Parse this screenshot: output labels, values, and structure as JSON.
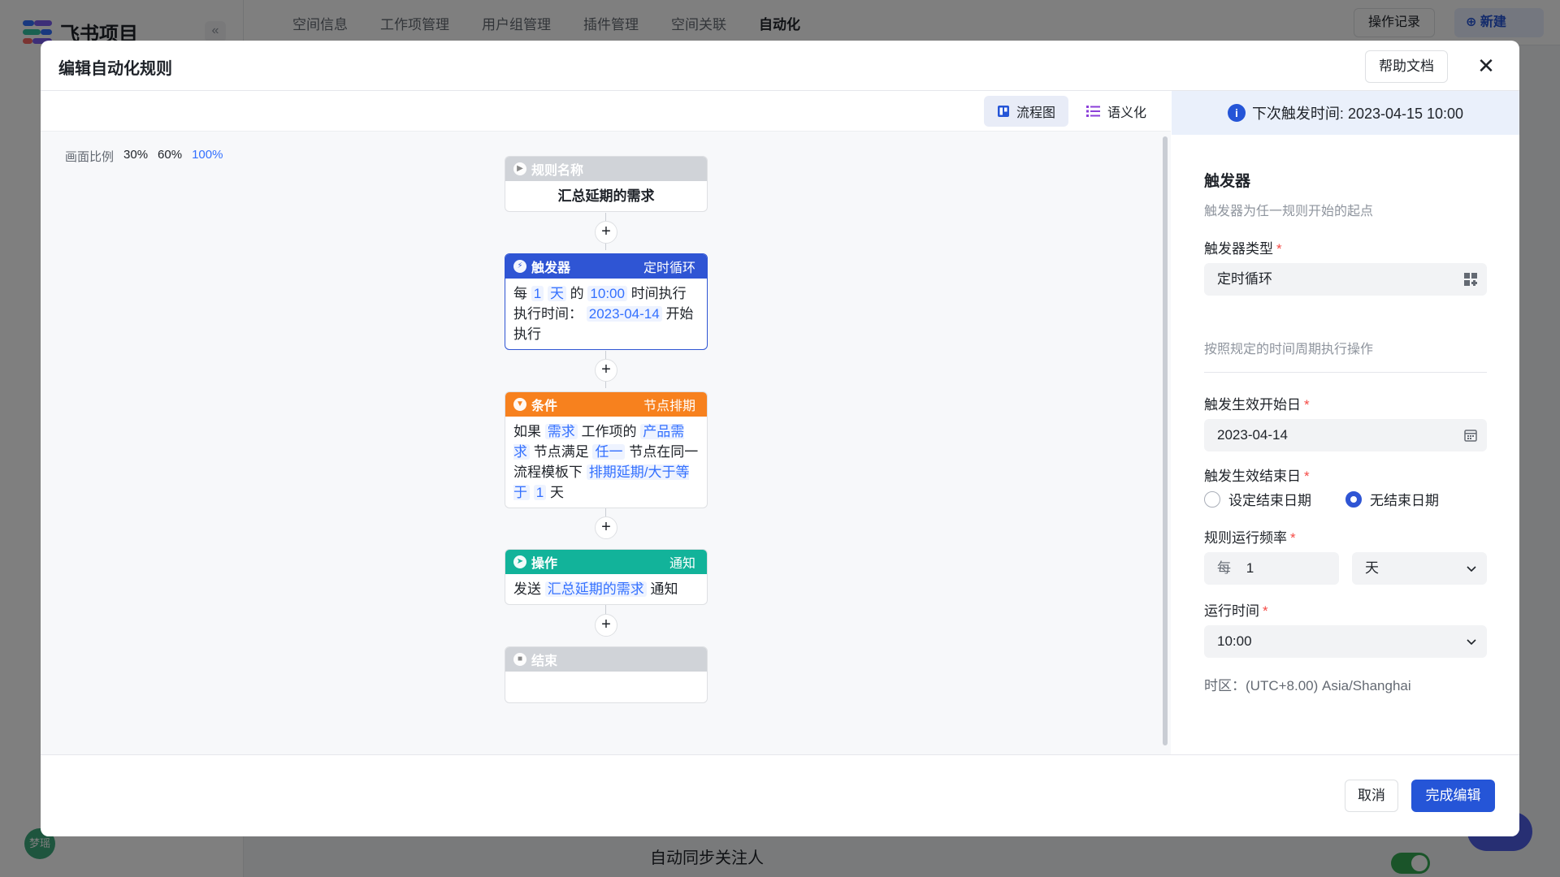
{
  "app": {
    "title": "飞书项目",
    "tabs": [
      "空间信息",
      "工作项管理",
      "用户组管理",
      "插件管理",
      "空间关联",
      "自动化"
    ],
    "log_button": "操作记录",
    "new_button": "新建",
    "avatar": "梦瑶",
    "bg_row_label": "自动同步关注人"
  },
  "modal": {
    "title": "编辑自动化规则",
    "help_button": "帮助文档",
    "close_icon": "✕"
  },
  "view": {
    "flow_label": "流程图",
    "semantic_label": "语义化",
    "scale_label": "画面比例",
    "scales": [
      "30%",
      "60%",
      "100%"
    ],
    "active_scale": "100%"
  },
  "flow": {
    "rule_name": {
      "header": "规则名称",
      "value": "汇总延期的需求"
    },
    "trigger": {
      "header": "触发器",
      "type": "定时循环",
      "p1": "每",
      "t1": "1",
      "t2": "天",
      "p2": "的",
      "t3": "10:00",
      "p3": "时间执行",
      "p4": "执行时间：",
      "t4": "2023-04-14",
      "p5": "开始执行"
    },
    "condition": {
      "header": "条件",
      "type": "节点排期",
      "p1": "如果",
      "t1": "需求",
      "p2": "工作项的",
      "t2": "产品需求",
      "p3": "节点满足",
      "t3": "任一",
      "p4": "节点在同一流程模板下",
      "t4": "排期延期/大于等于",
      "t5": "1",
      "p5": "天"
    },
    "action": {
      "header": "操作",
      "type": "通知",
      "p1": "发送",
      "t1": "汇总延期的需求",
      "p2": "通知"
    },
    "end": {
      "header": "结束"
    },
    "plus": "+"
  },
  "panel": {
    "next_trigger": "下次触发时间: 2023-04-15 10:00",
    "title": "触发器",
    "subtitle": "触发器为任一规则开始的起点",
    "trigger_type_label": "触发器类型",
    "trigger_type_value": "定时循环",
    "trigger_type_hint": "按照规定的时间周期执行操作",
    "start_date_label": "触发生效开始日",
    "start_date_value": "2023-04-14",
    "end_date_label": "触发生效结束日",
    "end_option_set": "设定结束日期",
    "end_option_none": "无结束日期",
    "frequency_label": "规则运行频率",
    "frequency_prefix": "每",
    "frequency_value": "1",
    "frequency_unit": "天",
    "run_time_label": "运行时间",
    "run_time_value": "10:00",
    "timezone": "时区：(UTC+8.00) Asia/Shanghai",
    "required_mark": "*"
  },
  "footer": {
    "cancel_button": "取消",
    "done_button": "完成编辑"
  },
  "colors": {
    "primary": "#2555d7",
    "trigger_header": "#2f55d4",
    "condition_header": "#f7811e",
    "action_header": "#12b39a",
    "end_header": "#d0d3d8",
    "tag_text": "#3370ff",
    "required": "#f54a45"
  }
}
